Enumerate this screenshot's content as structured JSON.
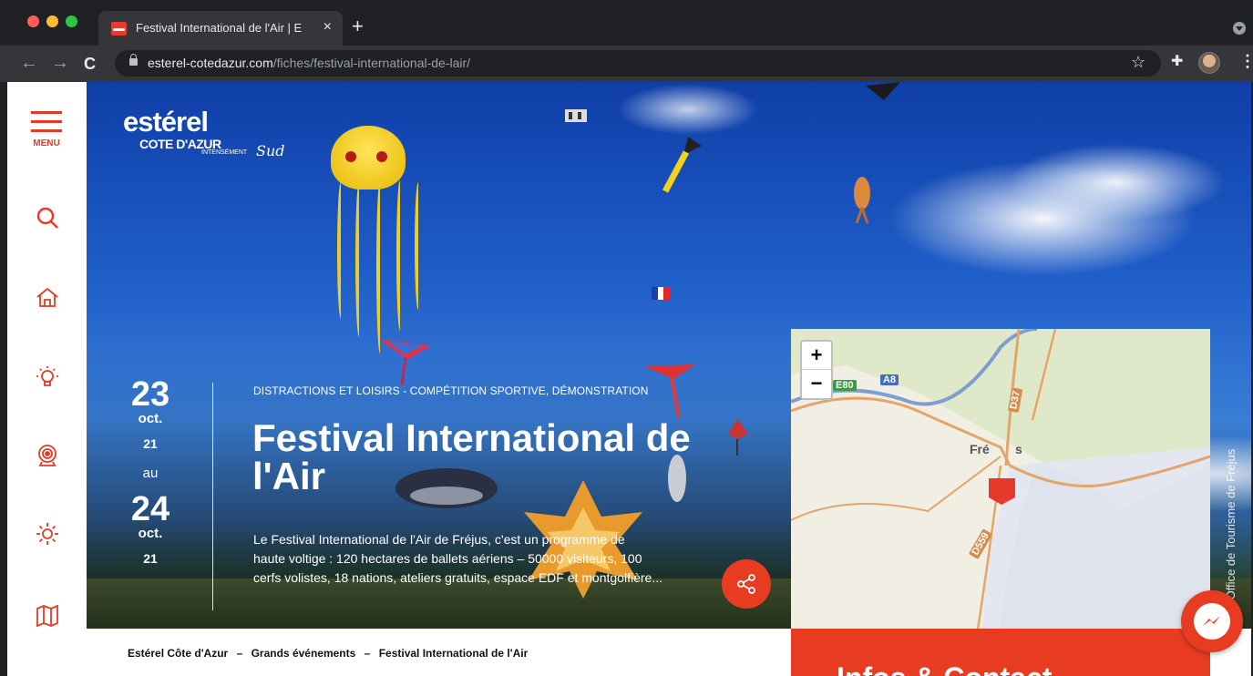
{
  "browser": {
    "tab_title": "Festival International de l'Air | E",
    "tab_close": "×",
    "new_tab": "+",
    "url_domain": "esterel-cotedazur.com",
    "url_path": "/fiches/festival-international-de-lair/",
    "nav_back": "←",
    "nav_forward": "→",
    "nav_reload": "C",
    "star": "☆",
    "extensions": "✚",
    "menu": "⋮"
  },
  "sidebar": {
    "menu_label": "MENU",
    "icons": [
      "search-icon",
      "home-icon",
      "lightbulb-icon",
      "webcam-icon",
      "sun-icon",
      "map-icon"
    ]
  },
  "logo": {
    "main": "estérel",
    "sub": "COTE D'AZUR",
    "tag": "INTENSÉMENT",
    "sud": "Sud"
  },
  "event": {
    "start_day": "23",
    "start_month": "oct.",
    "start_year": "21",
    "separator": "au",
    "end_day": "24",
    "end_month": "oct.",
    "end_year": "21",
    "category": "DISTRACTIONS ET LOISIRS - COMPÉTITION SPORTIVE, DÉMONSTRATION",
    "title": "Festival International de l'Air",
    "description_lines": [
      "Le Festival International de l'Air de Fréjus, c'est un programme de",
      "haute voltige : 120 hectares de ballets aériens – 50000 visiteurs, 100",
      "cerfs volistes, 18 nations, ateliers gratuits, espace EDF et montgolfière..."
    ]
  },
  "photo_credit": "©Office de Tourisme de Fréjus",
  "map": {
    "zoom_in": "+",
    "zoom_out": "−",
    "labels": [
      "E80",
      "A8",
      "D37",
      "Fré",
      "s",
      "D559"
    ]
  },
  "breadcrumb": {
    "items": [
      "Estérel Côte d'Azur",
      "Grands événements",
      "Festival International de l'Air"
    ],
    "separator": "–"
  },
  "infos": {
    "title": "Infos & Contact"
  },
  "colors": {
    "accent": "#e83c22",
    "chrome_bg": "#202124",
    "toolbar_bg": "#35363a"
  }
}
